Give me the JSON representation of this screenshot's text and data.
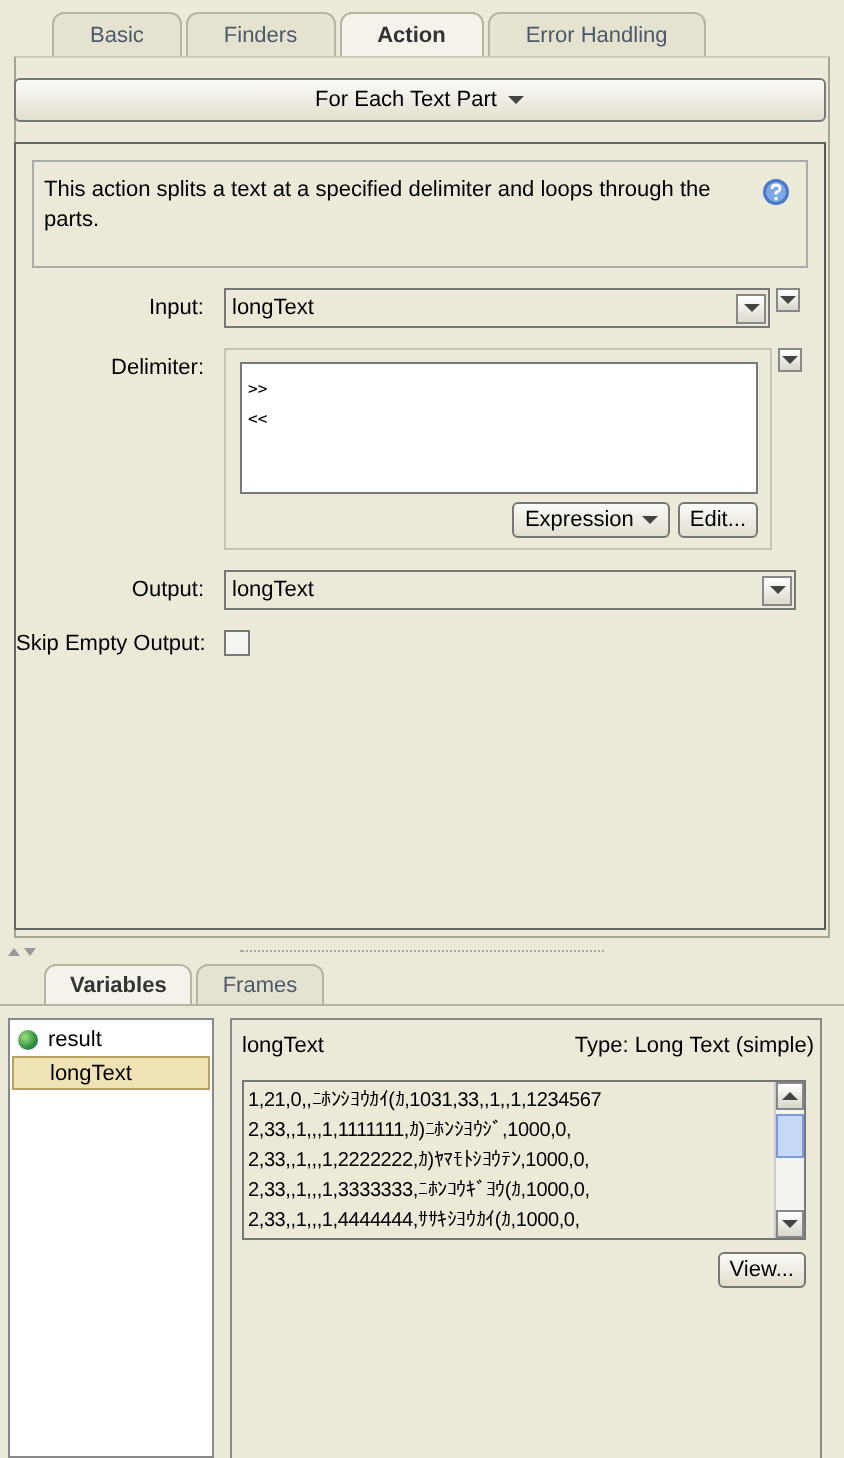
{
  "tabs": [
    {
      "label": "Basic",
      "selected": false
    },
    {
      "label": "Finders",
      "selected": false
    },
    {
      "label": "Action",
      "selected": true
    },
    {
      "label": "Error Handling",
      "selected": false
    }
  ],
  "action_menu": {
    "label": "For Each Text Part"
  },
  "description": "This action splits a text at a specified delimiter and loops through the parts.",
  "input": {
    "label": "Input:",
    "value": "longText"
  },
  "delimiter": {
    "label": "Delimiter:",
    "lines": [
      ">>",
      "<<"
    ],
    "mode_button": "Expression",
    "edit_button": "Edit..."
  },
  "output": {
    "label": "Output:",
    "value": "longText"
  },
  "skip_empty_output": {
    "label": "Skip Empty Output:",
    "checked": false
  },
  "bottom_tabs": [
    {
      "label": "Variables",
      "selected": true
    },
    {
      "label": "Frames",
      "selected": false
    }
  ],
  "variables": [
    {
      "name": "result",
      "selected": false,
      "kind": "global"
    },
    {
      "name": "longText",
      "selected": true,
      "kind": "plain"
    }
  ],
  "detail": {
    "name": "longText",
    "type": "Type: Long Text (simple)",
    "lines": [
      "1,21,0,,ﾆﾎﾝｼﾖｳｶｲ(ｶ,1031,33,,1,,1,1234567",
      "2,33,,1,,,1,1111111,ｶ)ﾆﾎﾝｼﾖｳｼﾞ,1000,0,",
      "2,33,,1,,,1,2222222,ｶ)ﾔﾏﾓﾄｼﾖｳﾃﾝ,1000,0,",
      "2,33,,1,,,1,3333333,ﾆﾎﾝｺｳｷﾞﾖｳ(ｶ,1000,0,",
      "2,33,,1,,,1,4444444,ｻｻｷｼﾖｳｶｲ(ｶ,1000,0,"
    ],
    "view_button": "View..."
  }
}
